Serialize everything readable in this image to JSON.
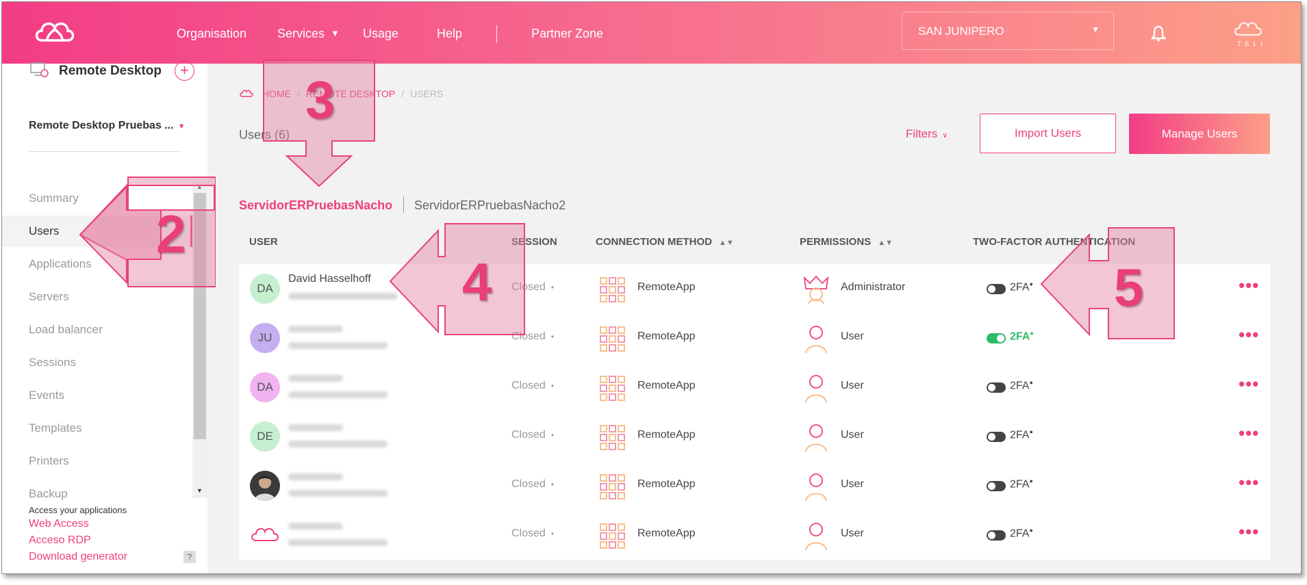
{
  "header": {
    "nav": [
      "Organisation",
      "Services",
      "Usage",
      "Help",
      "Partner Zone"
    ],
    "org_select": "SAN JUNIPERO",
    "brand_text": "TELI"
  },
  "sidebar": {
    "title": "Remote Desktop",
    "selector": "Remote Desktop Pruebas ...",
    "items": [
      "Summary",
      "Users",
      "Applications",
      "Servers",
      "Load balancer",
      "Sessions",
      "Events",
      "Templates",
      "Printers",
      "Backup"
    ],
    "active_item": "Users",
    "access_label": "Access your applications",
    "links": [
      "Web Access",
      "Acceso RDP",
      "Download generator"
    ],
    "help": "?"
  },
  "main": {
    "breadcrumb": [
      "HOME",
      "REMOTE DESKTOP",
      "USERS"
    ],
    "users_count": "Users (6)",
    "filters_label": "Filters",
    "import_label": "Import Users",
    "manage_label": "Manage Users",
    "tabs": [
      "ServidorERPruebasNacho",
      "ServidorERPruebasNacho2"
    ],
    "columns": [
      "USER",
      "SESSION",
      "CONNECTION METHOD",
      "PERMISSIONS",
      "TWO-FACTOR AUTHENTICATION"
    ],
    "rows": [
      {
        "initials": "DA",
        "name": "David Hasselhoff",
        "session": "Closed",
        "method": "RemoteApp",
        "permission": "Administrator",
        "twofa": "2FA",
        "twofa_on": false,
        "avatar_color": "#c6efcf"
      },
      {
        "initials": "JU",
        "name": "",
        "session": "Closed",
        "method": "RemoteApp",
        "permission": "User",
        "twofa": "2FA",
        "twofa_on": true,
        "avatar_color": "#c4aef0"
      },
      {
        "initials": "DA",
        "name": "",
        "session": "Closed",
        "method": "RemoteApp",
        "permission": "User",
        "twofa": "2FA",
        "twofa_on": false,
        "avatar_color": "#f0b3f0"
      },
      {
        "initials": "DE",
        "name": "",
        "session": "Closed",
        "method": "RemoteApp",
        "permission": "User",
        "twofa": "2FA",
        "twofa_on": false,
        "avatar_color": "#c6efcf"
      },
      {
        "initials": "",
        "name": "",
        "session": "Closed",
        "method": "RemoteApp",
        "permission": "User",
        "twofa": "2FA",
        "twofa_on": false,
        "avatar_color": "photo"
      },
      {
        "initials": "",
        "name": "",
        "session": "Closed",
        "method": "RemoteApp",
        "permission": "User",
        "twofa": "2FA",
        "twofa_on": false,
        "avatar_color": "logo"
      }
    ],
    "actions_label": "•••"
  },
  "annotations": [
    "2",
    "3",
    "4",
    "5"
  ],
  "colors": {
    "accent": "#ee3f7e",
    "green": "#2dbb6c"
  }
}
